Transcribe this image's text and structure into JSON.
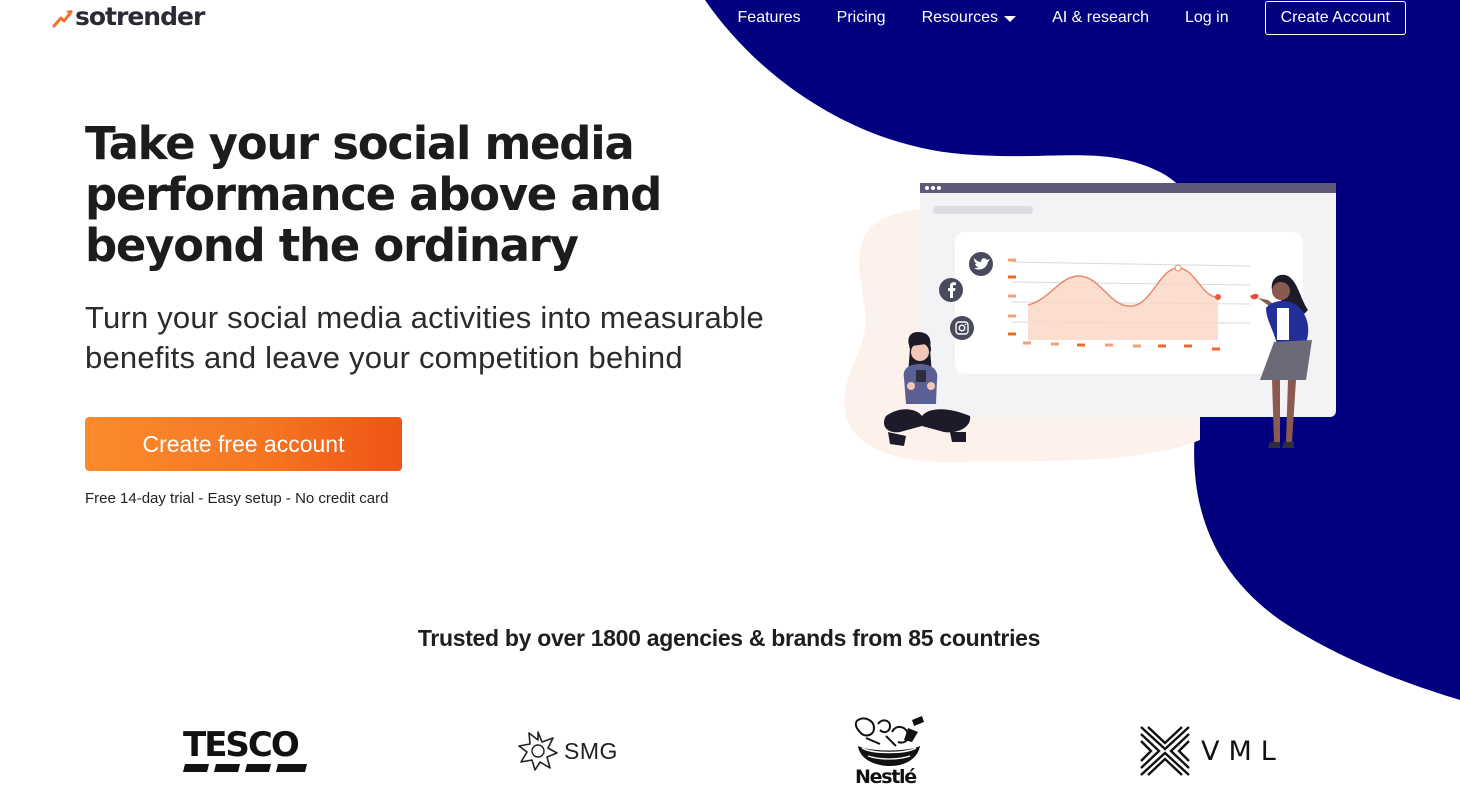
{
  "colors": {
    "navy": "#02007f",
    "orange": "#f57722",
    "text": "#1c1c1c"
  },
  "logo": {
    "text": "sotrender",
    "icon": "trend-arrow-icon"
  },
  "nav": {
    "features": "Features",
    "pricing": "Pricing",
    "resources": "Resources",
    "ai_research": "AI & research",
    "login": "Log in",
    "create_account": "Create Account"
  },
  "hero": {
    "title": "Take your social media performance above and beyond the ordinary",
    "subtitle": "Turn your social media activities into measurable benefits and leave your competition behind",
    "cta": "Create free account",
    "note": "Free 14-day trial - Easy setup - No credit card"
  },
  "illustration": {
    "icons": [
      "twitter-icon",
      "facebook-icon",
      "instagram-icon"
    ]
  },
  "trusted": {
    "headline": "Trusted by over 1800 agencies & brands from 85 countries"
  },
  "brands": {
    "tesco": "TESCO",
    "smg": "SMG",
    "nestle": "Nestlé",
    "vml": "VML"
  }
}
